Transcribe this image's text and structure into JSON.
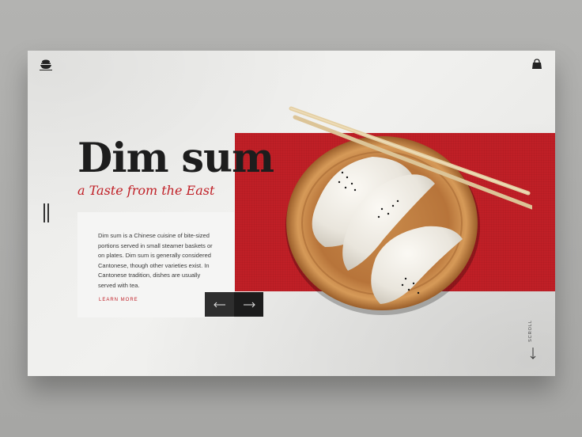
{
  "brand": {
    "logo_icon": "steamer-bowl-icon"
  },
  "header": {
    "cart_icon": "shopping-bag-icon"
  },
  "hero": {
    "title": "Dim sum",
    "subtitle": "a Taste from the East",
    "description": "Dim sum is a Chinese cuisine of bite-sized portions served in small steamer baskets or on plates. Dim sum is generally considered Cantonese, though other varieties exist. In Cantonese tradition, dishes are usually served with tea.",
    "cta": "LEARN MORE"
  },
  "nav": {
    "prev_icon": "arrow-left-icon",
    "next_icon": "arrow-right-icon"
  },
  "scroll": {
    "label": "SCROLL",
    "icon": "arrow-down-icon"
  },
  "colors": {
    "accent": "#c01f26",
    "dark": "#1d1d1d",
    "background": "#ededeb"
  }
}
